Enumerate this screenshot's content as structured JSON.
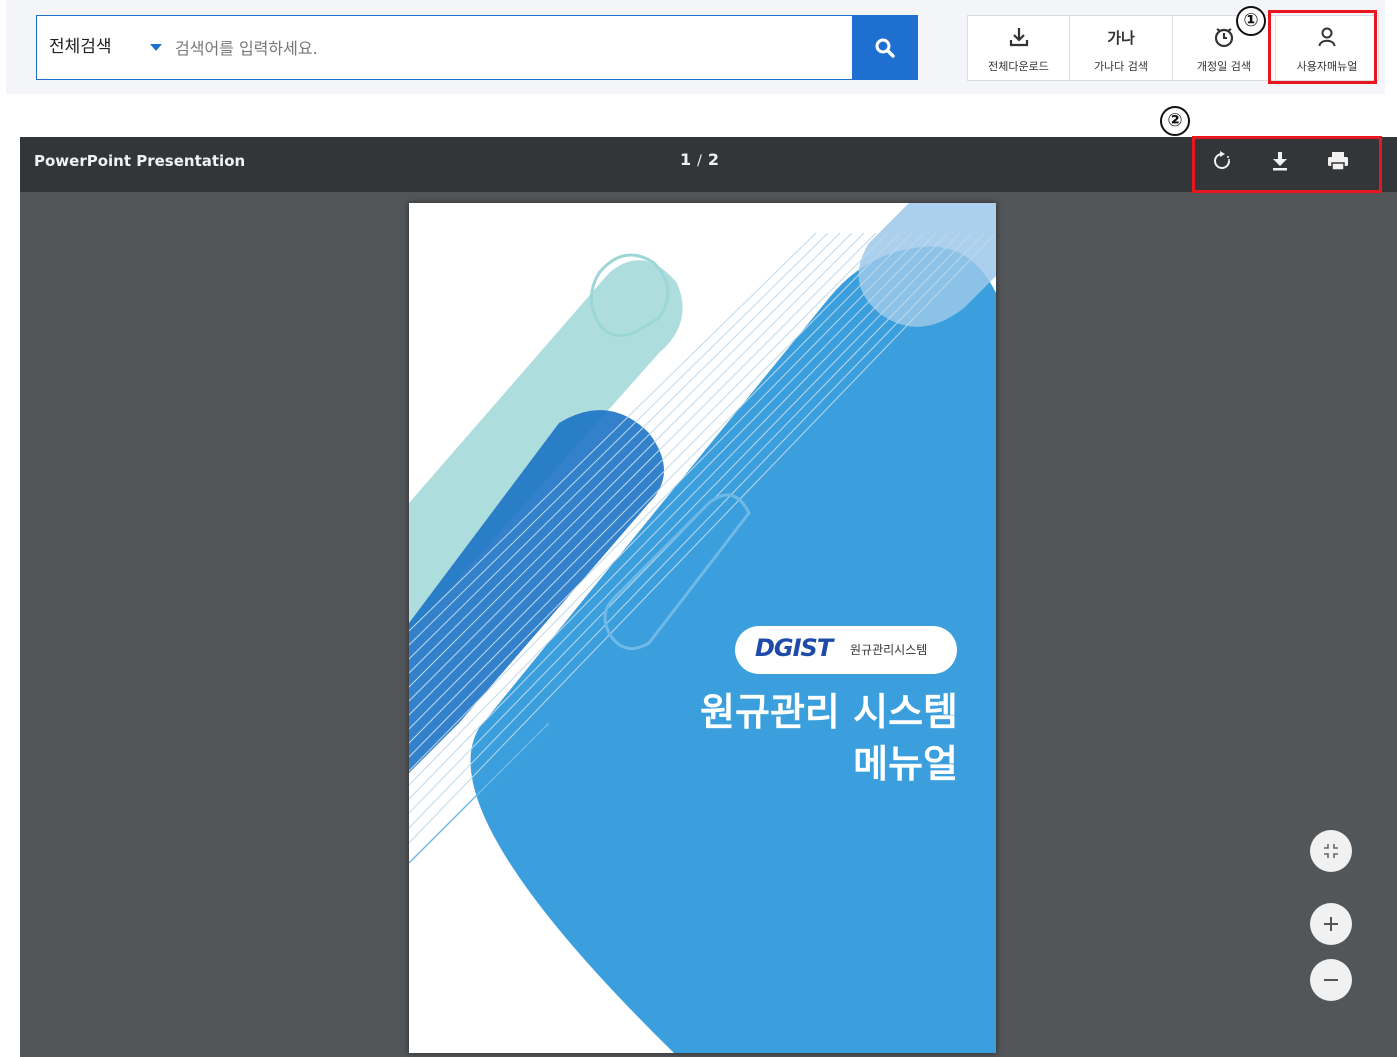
{
  "search": {
    "scope": "전체검색",
    "placeholder": "검색어를 입력하세요."
  },
  "tools": [
    {
      "label": "전체다운로드",
      "icon": "download-icon"
    },
    {
      "label": "가나다 검색",
      "icon": "hangul-sort-icon",
      "glyph": "가나"
    },
    {
      "label": "개정일 검색",
      "icon": "clock-icon"
    },
    {
      "label": "사용자매뉴얼",
      "icon": "user-icon"
    }
  ],
  "markers": [
    "①",
    "②"
  ],
  "viewer": {
    "title": "PowerPoint Presentation",
    "current_page": "1",
    "separator": "/",
    "total_pages": "2"
  },
  "document": {
    "logo": "DGIST",
    "logo_sub": "원규관리시스템",
    "title_line1": "원규관리 시스템",
    "title_line2": "메뉴얼"
  },
  "colors": {
    "accent": "#1f6fd1",
    "highlight": "#e8171f",
    "viewer_bg": "#525659",
    "viewer_toolbar": "#323639",
    "cover_blue": "#3a9fdc"
  }
}
